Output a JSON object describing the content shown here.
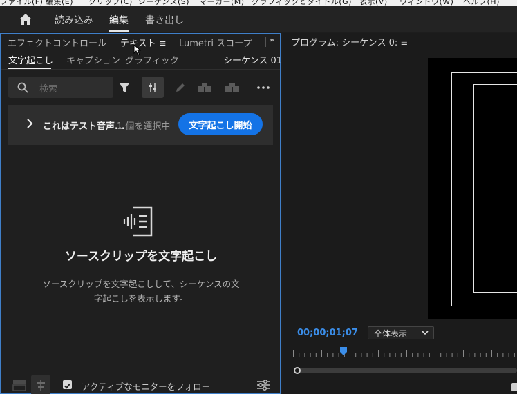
{
  "menubar": {
    "items": [
      "ファイル(F)",
      "編集(E)",
      "クリップ(C)",
      "シーケンス(S)",
      "マーカー(M)",
      "グラフィックとタイトル(G)",
      "表示(V)",
      "ウィンドウ(W)",
      "ヘルプ(H)"
    ]
  },
  "workspace": {
    "tabs": [
      {
        "label": "読み込み"
      },
      {
        "label": "編集"
      },
      {
        "label": "書き出し"
      }
    ],
    "active": "編集"
  },
  "left_panel": {
    "tabs": [
      "エフェクトコントロール",
      "テキスト ≡",
      "Lumetri スコープ"
    ],
    "active_tab": "テキスト ≡",
    "overflow_glyph": "»",
    "subtabs": [
      "文字起こし",
      "キャプション",
      "グラフィック"
    ],
    "active_subtab": "文字起こし",
    "sequence_label": "シーケンス 01",
    "search": {
      "placeholder": "検索"
    },
    "clip_bar": {
      "clip_name": "これはテスト音声...",
      "selection_text": "1 個を選択中",
      "button_label": "文字起こし開始"
    },
    "empty_state": {
      "title": "ソースクリップを文字起こし",
      "description": "ソースクリップを文字起こしして、シーケンスの文字起こしを表示します。"
    },
    "footer": {
      "follow_label": "アクティブなモニターをフォロー",
      "follow_checked": true
    }
  },
  "program_monitor": {
    "title": "プログラム: シーケンス 0: ≡",
    "timecode": "00;00;01;07",
    "zoom_label": "全体表示"
  },
  "colors": {
    "accent": "#1473e6",
    "timecode": "#3b8eea",
    "panel_focus_border": "#3f7fc9"
  }
}
